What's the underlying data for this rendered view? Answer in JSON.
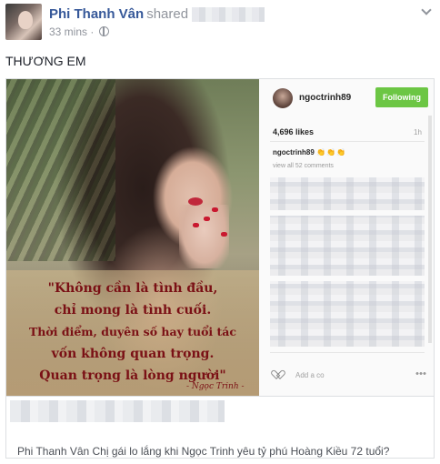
{
  "post": {
    "author_name": "Phi Thanh Vân",
    "action": "shared",
    "timestamp": "33 mins",
    "separator": "·",
    "privacy_icon": "globe-icon",
    "menu_icon": "chevron-down-icon",
    "status_text": "THƯƠNG EM"
  },
  "image": {
    "quote_lines": [
      "\"Không cần là tình đầu,",
      "chỉ mong là tình cuối.",
      "Thời điểm, duyên số hay tuổi tác",
      "vốn không quan trọng.",
      "Quan trọng là lòng người\""
    ],
    "signature": "- Ngọc Trinh -"
  },
  "instagram": {
    "username": "ngoctrinh89",
    "follow_label": "Following",
    "likes": "4,696 likes",
    "time": "1h",
    "caption_user": "ngoctrinh89",
    "caption_emoji": "👏👏👏",
    "view_comments": "view all 52 comments",
    "add_comment_placeholder": "Add a co",
    "accent_color": "#6cc644"
  },
  "link_preview": {
    "title": "Phi Thanh Vân Chị gái lo lắng khi Ngọc Trinh yêu tỷ phú Hoàng Kiều 72 tuổi?"
  },
  "colors": {
    "link_blue": "#365899",
    "meta_gray": "#90949c",
    "quote_text": "#7a1015"
  }
}
